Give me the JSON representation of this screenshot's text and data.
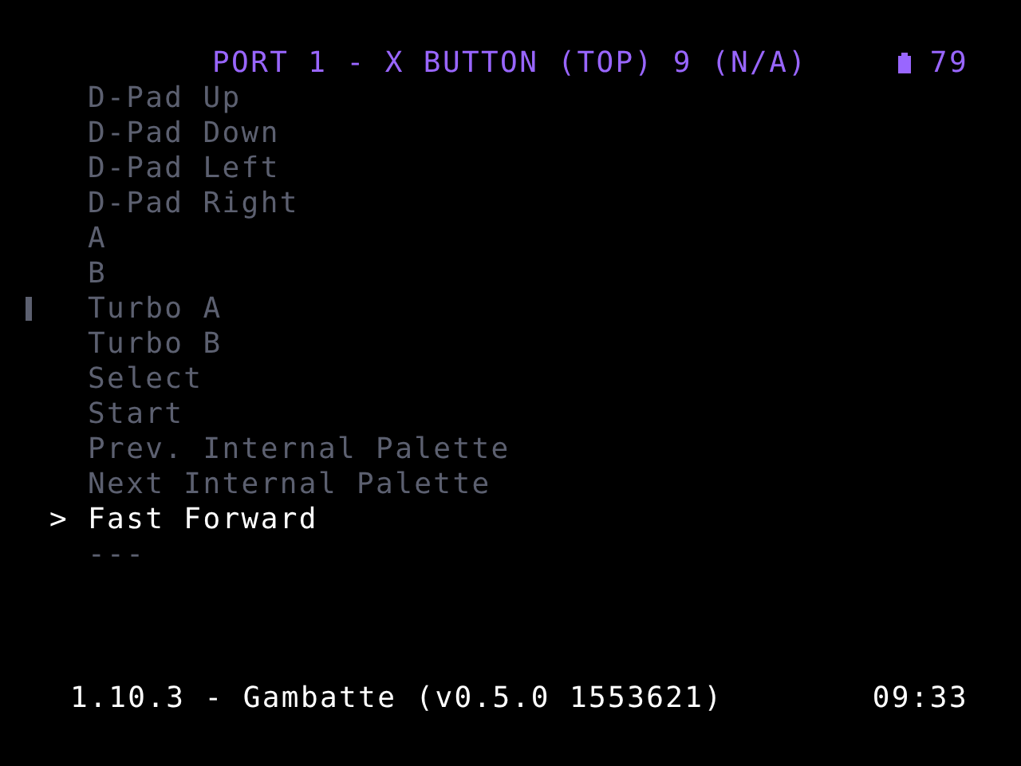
{
  "header": {
    "title": "PORT 1 - X BUTTON (TOP) 9 (N/A)",
    "battery": "79"
  },
  "cursor": ">",
  "items": [
    {
      "label": "D-Pad Up",
      "selected": false
    },
    {
      "label": "D-Pad Down",
      "selected": false
    },
    {
      "label": "D-Pad Left",
      "selected": false
    },
    {
      "label": "D-Pad Right",
      "selected": false
    },
    {
      "label": "A",
      "selected": false
    },
    {
      "label": "B",
      "selected": false
    },
    {
      "label": "Turbo A",
      "selected": false
    },
    {
      "label": "Turbo B",
      "selected": false
    },
    {
      "label": "Select",
      "selected": false
    },
    {
      "label": "Start",
      "selected": false
    },
    {
      "label": "Prev. Internal Palette",
      "selected": false
    },
    {
      "label": "Next Internal Palette",
      "selected": false
    },
    {
      "label": "Fast Forward",
      "selected": true
    },
    {
      "label": "---",
      "selected": false
    }
  ],
  "footer": {
    "core": "1.10.3 - Gambatte (v0.5.0 1553621)",
    "clock": "09:33"
  }
}
